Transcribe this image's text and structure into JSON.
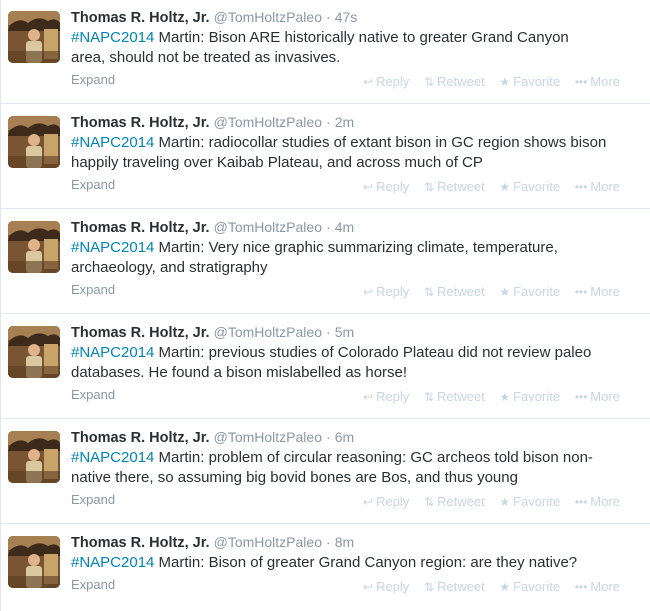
{
  "colors": {
    "hashtag": "#0084b4",
    "meta": "#8899a6",
    "action": "#c8d6e0"
  },
  "tweets": [
    {
      "fullname": "Thomas R. Holtz, Jr.",
      "username": "@TomHoltzPaleo",
      "dot": "·",
      "time": "47s",
      "hashtag": "#NAPC2014",
      "text": " Martin: Bison ARE historically native to greater Grand Canyon\narea, should not be treated as invasives.",
      "expand": "Expand",
      "reply": "Reply",
      "retweet": "Retweet",
      "favorite": "Favorite",
      "more": "More"
    },
    {
      "fullname": "Thomas R. Holtz, Jr.",
      "username": "@TomHoltzPaleo",
      "dot": "·",
      "time": "2m",
      "hashtag": "#NAPC2014",
      "text": " Martin: radiocollar studies of extant bison in GC region shows bison\nhappily traveling over Kaibab Plateau, and across much of CP",
      "expand": "Expand",
      "reply": "Reply",
      "retweet": "Retweet",
      "favorite": "Favorite",
      "more": "More"
    },
    {
      "fullname": "Thomas R. Holtz, Jr.",
      "username": "@TomHoltzPaleo",
      "dot": "·",
      "time": "4m",
      "hashtag": "#NAPC2014",
      "text": " Martin: Very nice graphic summarizing climate, temperature,\narchaeology, and stratigraphy",
      "expand": "Expand",
      "reply": "Reply",
      "retweet": "Retweet",
      "favorite": "Favorite",
      "more": "More"
    },
    {
      "fullname": "Thomas R. Holtz, Jr.",
      "username": "@TomHoltzPaleo",
      "dot": "·",
      "time": "5m",
      "hashtag": "#NAPC2014",
      "text": " Martin: previous studies of Colorado Plateau did not review paleo\ndatabases. He found a bison mislabelled as horse!",
      "expand": "Expand",
      "reply": "Reply",
      "retweet": "Retweet",
      "favorite": "Favorite",
      "more": "More"
    },
    {
      "fullname": "Thomas R. Holtz, Jr.",
      "username": "@TomHoltzPaleo",
      "dot": "·",
      "time": "6m",
      "hashtag": "#NAPC2014",
      "text": " Martin: problem of circular reasoning: GC archeos told bison non-\nnative there, so assuming big bovid bones are Bos, and thus young",
      "expand": "Expand",
      "reply": "Reply",
      "retweet": "Retweet",
      "favorite": "Favorite",
      "more": "More"
    },
    {
      "fullname": "Thomas R. Holtz, Jr.",
      "username": "@TomHoltzPaleo",
      "dot": "·",
      "time": "8m",
      "hashtag": "#NAPC2014",
      "text": " Martin: Bison of greater Grand Canyon region: are they native?",
      "expand": "Expand",
      "reply": "Reply",
      "retweet": "Retweet",
      "favorite": "Favorite",
      "more": "More"
    }
  ]
}
